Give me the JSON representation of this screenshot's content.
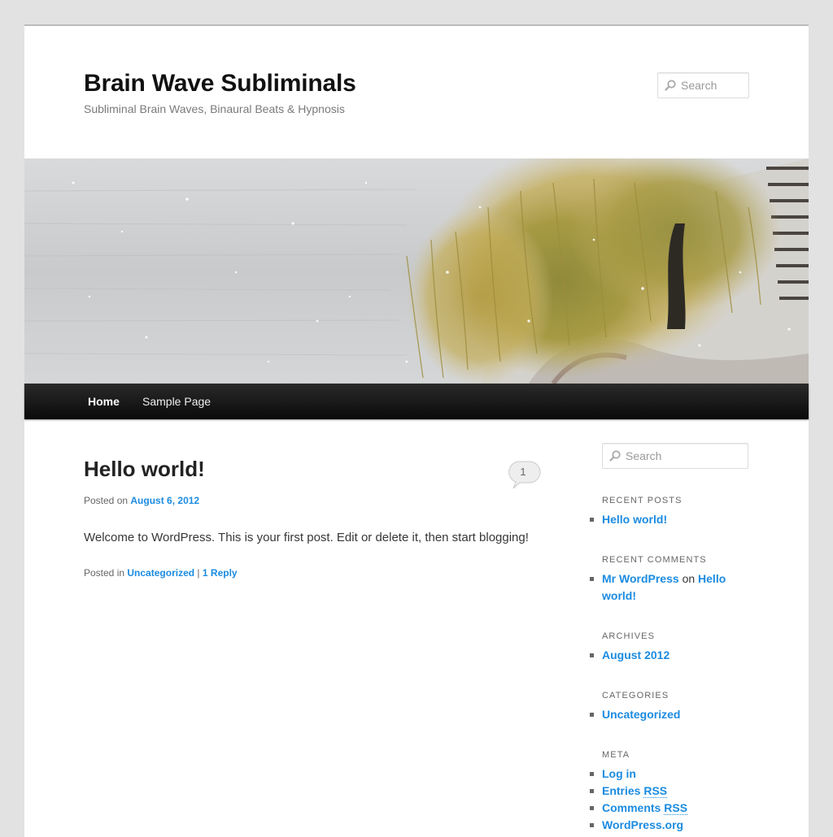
{
  "site": {
    "title": "Brain Wave Subliminals",
    "description": "Subliminal Brain Waves, Binaural Beats & Hypnosis"
  },
  "header_search": {
    "placeholder": "Search"
  },
  "nav": {
    "items": [
      {
        "label": "Home"
      },
      {
        "label": "Sample Page"
      }
    ]
  },
  "post": {
    "title": "Hello world!",
    "comment_count": "1",
    "posted_on_prefix": "Posted on",
    "date": "August 6, 2012",
    "content": "Welcome to WordPress. This is your first post. Edit or delete it, then start blogging!",
    "posted_in_prefix": "Posted in",
    "category": "Uncategorized",
    "separator": "|",
    "replies": "1 Reply"
  },
  "sidebar": {
    "search_placeholder": "Search",
    "recent_posts": {
      "title": "Recent Posts",
      "items": [
        "Hello world!"
      ]
    },
    "recent_comments": {
      "title": "Recent Comments",
      "author": "Mr WordPress",
      "on": "on",
      "post_line1": "Hello",
      "post_line2": "world!"
    },
    "archives": {
      "title": "Archives",
      "items": [
        "August 2012"
      ]
    },
    "categories": {
      "title": "Categories",
      "items": [
        "Uncategorized"
      ]
    },
    "meta": {
      "title": "Meta",
      "login": "Log in",
      "entries_prefix": "Entries",
      "comments_prefix": "Comments",
      "rss": "RSS",
      "wordpress_org": "WordPress.org"
    }
  },
  "colors": {
    "link": "#1b8be0",
    "nav_bg": "#111111",
    "page_bg": "#e2e2e2"
  }
}
